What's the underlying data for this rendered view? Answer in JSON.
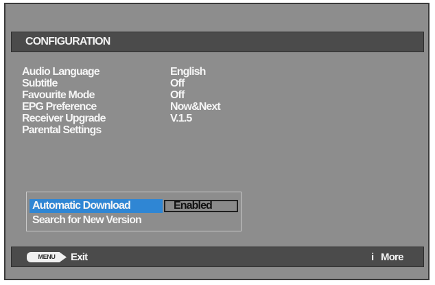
{
  "title": "CONFIGURATION",
  "settings": [
    {
      "label": "Audio Language",
      "value": "English"
    },
    {
      "label": "Subtitle",
      "value": "Off"
    },
    {
      "label": "Favourite Mode",
      "value": "Off"
    },
    {
      "label": "EPG Preference",
      "value": "Now&Next"
    },
    {
      "label": "Receiver Upgrade",
      "value": "V.1.5"
    },
    {
      "label": "Parental Settings",
      "value": ""
    }
  ],
  "upgrade_panel": {
    "automatic_download_label": "Automatic Download",
    "automatic_download_value": "Enabled",
    "search_label": "Search for New Version"
  },
  "footer": {
    "menu_button_label": "MENU",
    "exit_label": "Exit",
    "info_icon": "i",
    "more_label": "More"
  },
  "colors": {
    "background": "#8d8d8d",
    "bar": "#4b4b4b",
    "selection": "#2f86d4",
    "text": "#f5f5f5"
  }
}
